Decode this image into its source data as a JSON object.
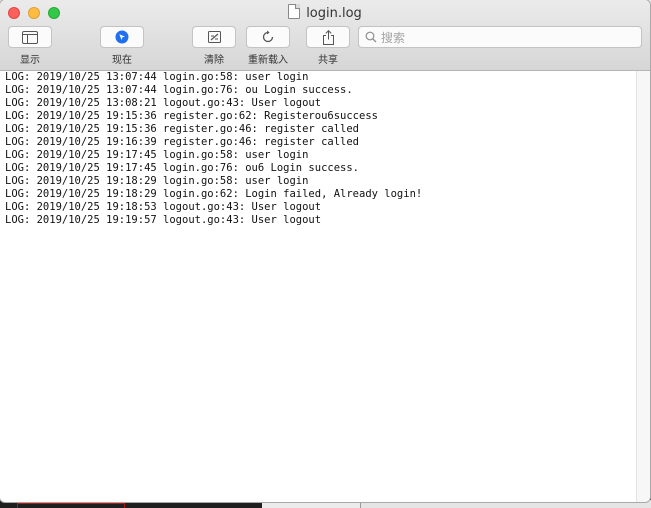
{
  "window": {
    "title": "login.log"
  },
  "toolbar": {
    "show_label": "显示",
    "now_label": "现在",
    "clear_label": "清除",
    "reload_label": "重新载入",
    "share_label": "共享",
    "search_placeholder": "搜索"
  },
  "icons": {
    "show": "sidebar-icon",
    "now": "location-icon",
    "clear": "trash-icon",
    "reload": "reload-icon",
    "share": "share-icon",
    "search": "magnifier-icon"
  },
  "colors": {
    "close": "#fc605c",
    "minimize": "#fdbc40",
    "maximize": "#34c84a",
    "accent": "#1f6ff0"
  },
  "log_lines": [
    "LOG: 2019/10/25 13:07:44 login.go:58: user login",
    "LOG: 2019/10/25 13:07:44 login.go:76: ou Login success.",
    "LOG: 2019/10/25 13:08:21 logout.go:43: User logout",
    "LOG: 2019/10/25 19:15:36 register.go:62: Registerou6success",
    "LOG: 2019/10/25 19:15:36 register.go:46: register called",
    "LOG: 2019/10/25 19:16:39 register.go:46: register called",
    "LOG: 2019/10/25 19:17:45 login.go:58: user login",
    "LOG: 2019/10/25 19:17:45 login.go:76: ou6 Login success.",
    "LOG: 2019/10/25 19:18:29 login.go:58: user login",
    "LOG: 2019/10/25 19:18:29 login.go:62: Login failed, Already login!",
    "LOG: 2019/10/25 19:18:53 logout.go:43: User logout",
    "LOG: 2019/10/25 19:19:57 logout.go:43: User logout"
  ]
}
